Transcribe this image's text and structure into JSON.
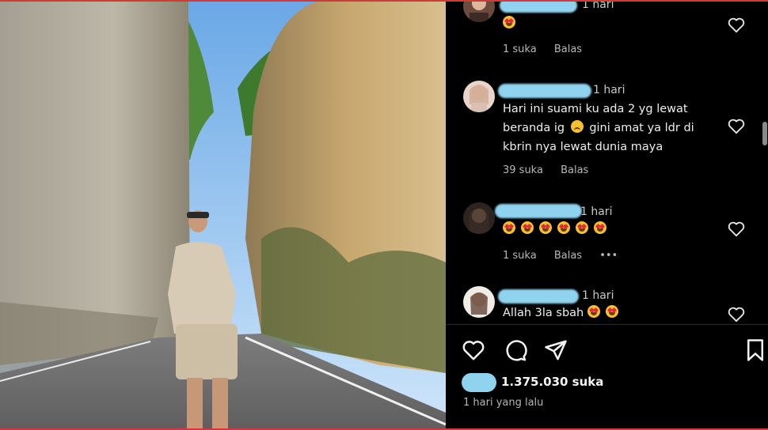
{
  "comments": [
    {
      "time": "1 hari",
      "text_lines": [],
      "emoji_count": 1,
      "likes": "1 suka",
      "reply": "Balas",
      "has_more": false
    },
    {
      "time": "1 hari",
      "text_lines": [
        "Hari ini suami ku ada 2 yg lewat",
        "beranda ig",
        "gini amat ya ldr di",
        "kbrin nya lewat dunia maya"
      ],
      "likes": "39 suka",
      "reply": "Balas",
      "has_more": false
    },
    {
      "time": "1 hari",
      "text_lines": [],
      "emoji_count": 6,
      "likes": "1 suka",
      "reply": "Balas",
      "more": "•••"
    },
    {
      "time": "1 hari",
      "text_lines": [
        "Allah 3la sbah"
      ],
      "emoji_count": 2
    }
  ],
  "post": {
    "likes_count": "1.375.030 suka",
    "posted_ago": "1 hari yang lalu"
  },
  "icons": [
    "heart-icon",
    "comment-icon",
    "share-icon",
    "bookmark-icon"
  ],
  "colors": {
    "frame_border": "#d23a3a",
    "blur_tint": "#8fd3ef",
    "panel_bg": "#000000"
  }
}
